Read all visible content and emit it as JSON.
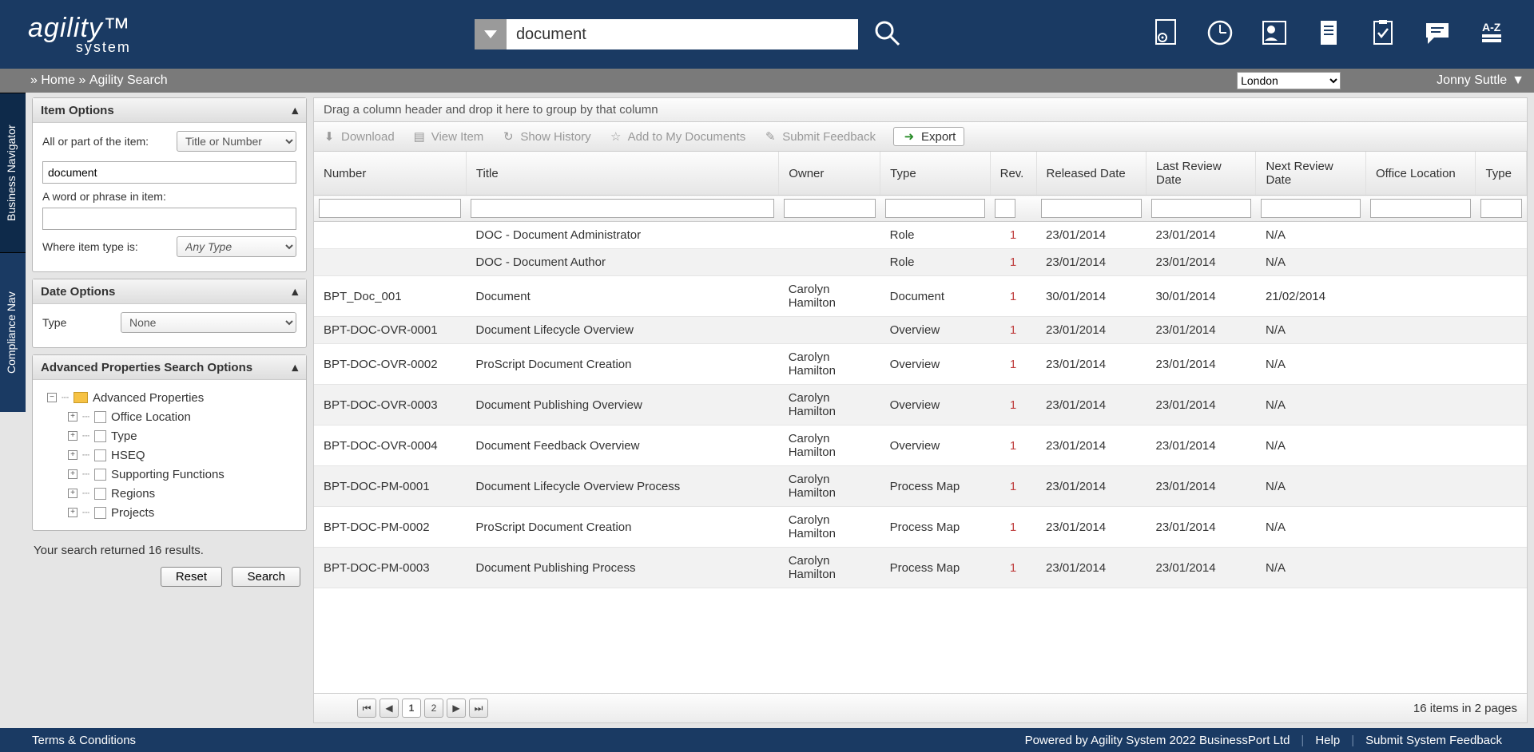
{
  "logo": {
    "line1": "agility™",
    "line2": "system"
  },
  "search": {
    "value": "document"
  },
  "breadcrumb": {
    "home": "Home",
    "sep": "»",
    "current": "Agility Search"
  },
  "location": {
    "selected": "London"
  },
  "user": "Jonny Suttle",
  "tabs": {
    "bn": "Business Navigator",
    "cn": "Compliance Nav"
  },
  "panels": {
    "item": {
      "title": "Item Options",
      "label1": "All or part of the item:",
      "sel1": "Title or Number",
      "value": "document",
      "label2": "A word or phrase in item:",
      "label3": "Where item type is:",
      "sel3": "Any Type"
    },
    "date": {
      "title": "Date Options",
      "label": "Type",
      "sel": "None"
    },
    "adv": {
      "title": "Advanced Properties Search Options",
      "root": "Advanced Properties",
      "items": [
        "Office Location",
        "Type",
        "HSEQ",
        "Supporting Functions",
        "Regions",
        "Projects"
      ]
    }
  },
  "status": "Your search returned 16 results.",
  "buttons": {
    "reset": "Reset",
    "search": "Search"
  },
  "group_hint": "Drag a column header and drop it here to group by that column",
  "toolbar": {
    "download": "Download",
    "view": "View Item",
    "history": "Show History",
    "add": "Add to My Documents",
    "feedback": "Submit Feedback",
    "export": "Export"
  },
  "cols": {
    "number": "Number",
    "title": "Title",
    "owner": "Owner",
    "type": "Type",
    "rev": "Rev.",
    "released": "Released Date",
    "last": "Last Review Date",
    "next": "Next Review Date",
    "office": "Office Location",
    "type2": "Type"
  },
  "rows": [
    {
      "number": "",
      "title": "DOC - Document Administrator",
      "owner": "",
      "type": "Role",
      "rev": "1",
      "released": "23/01/2014",
      "last": "23/01/2014",
      "next": "N/A",
      "office": "",
      "type2": ""
    },
    {
      "number": "",
      "title": "DOC - Document Author",
      "owner": "",
      "type": "Role",
      "rev": "1",
      "released": "23/01/2014",
      "last": "23/01/2014",
      "next": "N/A",
      "office": "",
      "type2": ""
    },
    {
      "number": "BPT_Doc_001",
      "title": "Document",
      "owner": "Carolyn Hamilton",
      "type": "Document",
      "rev": "1",
      "released": "30/01/2014",
      "last": "30/01/2014",
      "next": "21/02/2014",
      "office": "",
      "type2": ""
    },
    {
      "number": "BPT-DOC-OVR-0001",
      "title": "Document Lifecycle Overview",
      "owner": "",
      "type": "Overview",
      "rev": "1",
      "released": "23/01/2014",
      "last": "23/01/2014",
      "next": "N/A",
      "office": "",
      "type2": ""
    },
    {
      "number": "BPT-DOC-OVR-0002",
      "title": "ProScript Document Creation",
      "owner": "Carolyn Hamilton",
      "type": "Overview",
      "rev": "1",
      "released": "23/01/2014",
      "last": "23/01/2014",
      "next": "N/A",
      "office": "",
      "type2": ""
    },
    {
      "number": "BPT-DOC-OVR-0003",
      "title": "Document Publishing Overview",
      "owner": "Carolyn Hamilton",
      "type": "Overview",
      "rev": "1",
      "released": "23/01/2014",
      "last": "23/01/2014",
      "next": "N/A",
      "office": "",
      "type2": ""
    },
    {
      "number": "BPT-DOC-OVR-0004",
      "title": "Document Feedback Overview",
      "owner": "Carolyn Hamilton",
      "type": "Overview",
      "rev": "1",
      "released": "23/01/2014",
      "last": "23/01/2014",
      "next": "N/A",
      "office": "",
      "type2": ""
    },
    {
      "number": "BPT-DOC-PM-0001",
      "title": "Document Lifecycle Overview Process",
      "owner": "Carolyn Hamilton",
      "type": "Process Map",
      "rev": "1",
      "released": "23/01/2014",
      "last": "23/01/2014",
      "next": "N/A",
      "office": "",
      "type2": ""
    },
    {
      "number": "BPT-DOC-PM-0002",
      "title": "ProScript Document Creation",
      "owner": "Carolyn Hamilton",
      "type": "Process Map",
      "rev": "1",
      "released": "23/01/2014",
      "last": "23/01/2014",
      "next": "N/A",
      "office": "",
      "type2": ""
    },
    {
      "number": "BPT-DOC-PM-0003",
      "title": "Document Publishing Process",
      "owner": "Carolyn Hamilton",
      "type": "Process Map",
      "rev": "1",
      "released": "23/01/2014",
      "last": "23/01/2014",
      "next": "N/A",
      "office": "",
      "type2": ""
    }
  ],
  "pager": {
    "pages": [
      "1",
      "2"
    ],
    "current": "1",
    "info": "16 items in 2 pages"
  },
  "footer": {
    "terms": "Terms & Conditions",
    "powered": "Powered by Agility System 2022 BusinessPort Ltd",
    "help": "Help",
    "feedback": "Submit System Feedback"
  }
}
